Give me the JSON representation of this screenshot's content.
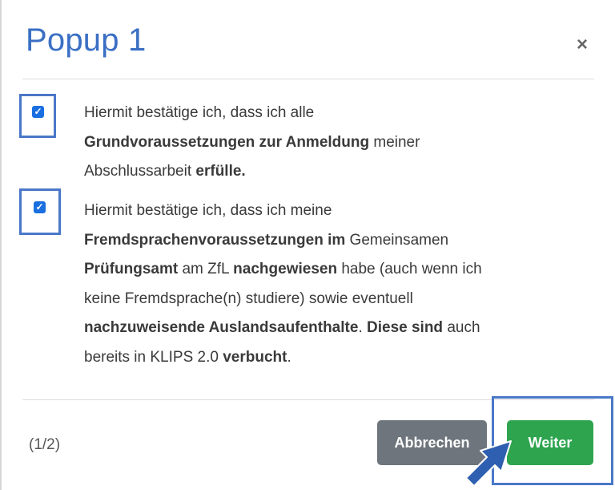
{
  "dialog": {
    "title": "Popup 1",
    "close_symbol": "×",
    "pager": "(1/2)",
    "cancel_label": "Abbrechen",
    "next_label": "Weiter"
  },
  "items": [
    {
      "checked": true,
      "checkmark": "✓",
      "line1": "Hiermit bestätige ich, dass ich alle",
      "line2_bold": "Grundvoraussetzungen zur Anmeldung",
      "line2_rest": " meiner",
      "line3_plain": "Abschlussarbeit ",
      "line3_bold": "erfülle."
    },
    {
      "checked": true,
      "checkmark": "✓",
      "line1": "Hiermit bestätige ich, dass ich meine",
      "line2_bold": "Fremdsprachenvoraussetzungen im",
      "line2_rest": " Gemeinsamen",
      "line3_bold": "Prüfungsamt",
      "line3_mid": " am ZfL ",
      "line3_bold2": "nachgewiesen",
      "line3_rest": " habe (auch wenn ich",
      "line4": "keine Fremdsprache(n) studiere) sowie eventuell",
      "line5_bold": "nachzuweisende Auslandsaufenthalte",
      "line5_mid": ". ",
      "line5_bold2": "Diese sind",
      "line5_rest": " auch",
      "line6_plain": "bereits in KLIPS 2.0 ",
      "line6_bold": "verbucht",
      "line6_end": "."
    }
  ],
  "colors": {
    "title": "#3a6fc4",
    "highlight": "#4a78c8",
    "checkbox": "#1a6fe0",
    "cancel_button": "#6e757c",
    "next_button": "#2ea44f",
    "pointer": "#2f5fb0"
  },
  "icons": {
    "close": "close-icon",
    "checkbox": "checkbox-checked-icon",
    "pointer": "arrow-pointer-icon"
  }
}
